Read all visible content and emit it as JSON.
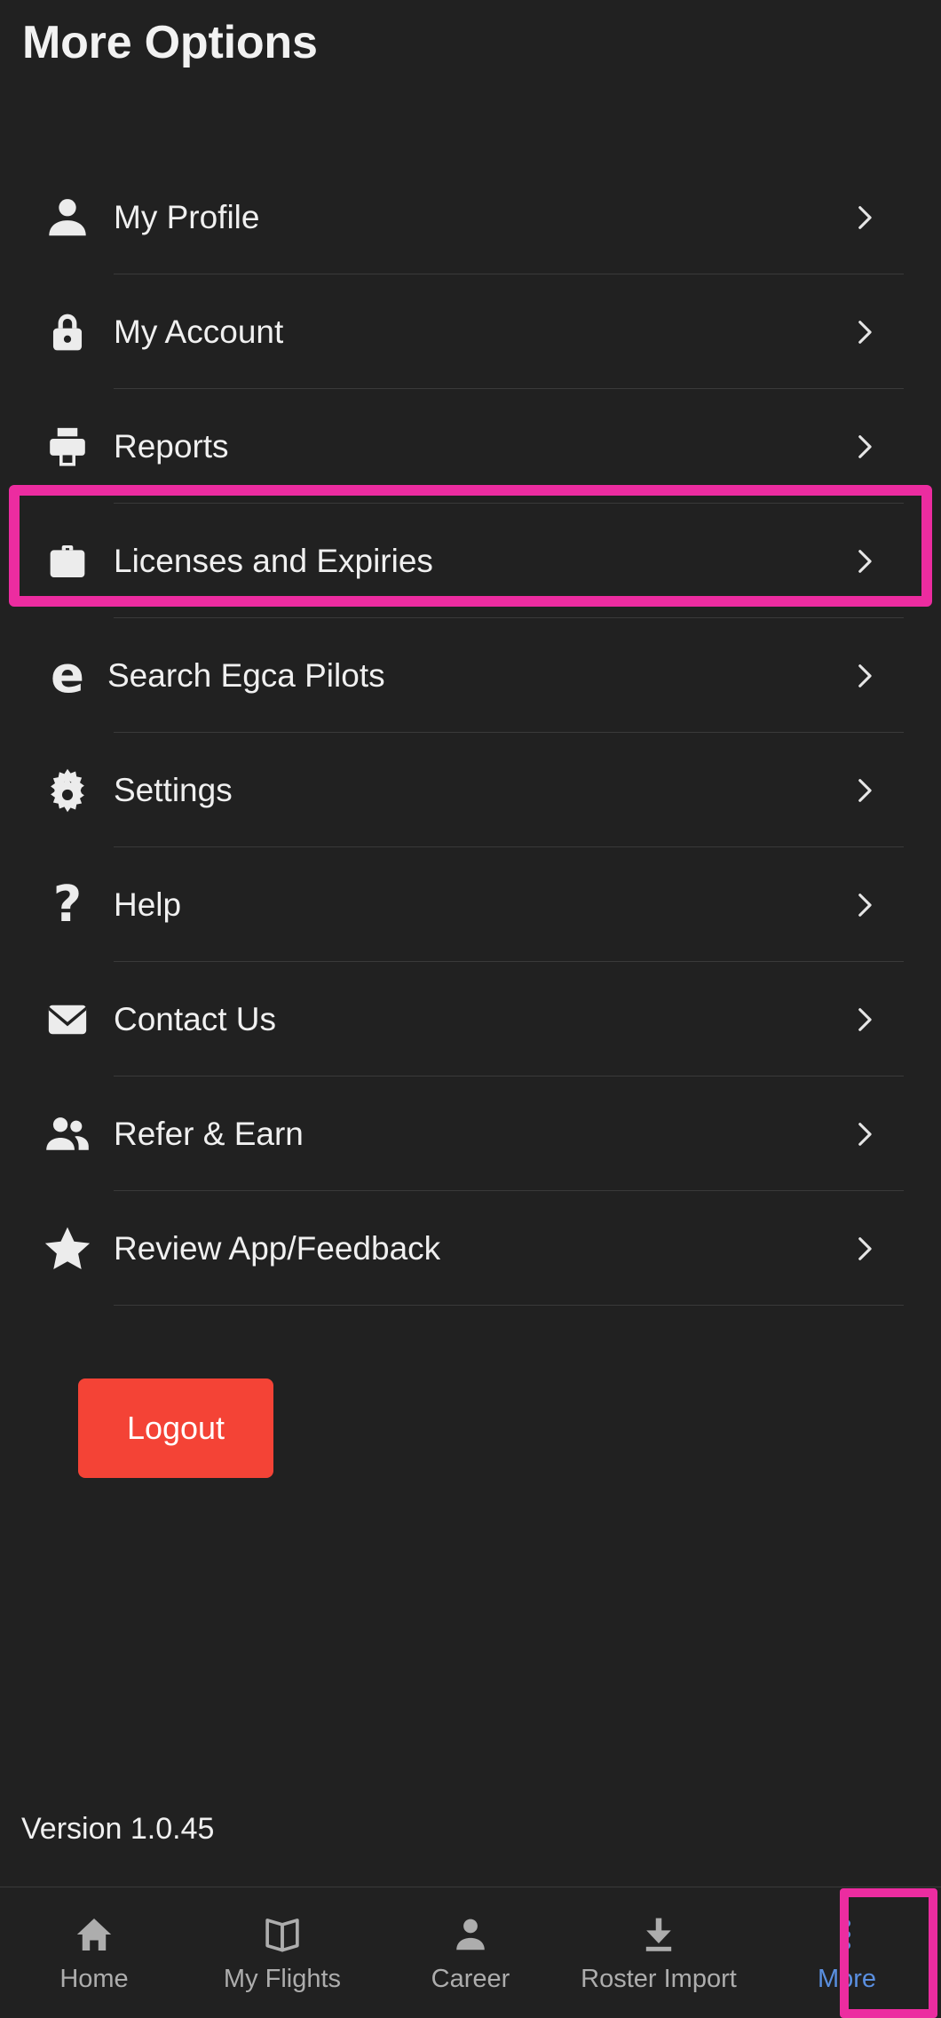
{
  "header": {
    "title": "More Options"
  },
  "menu": {
    "items": [
      {
        "label": "My Profile",
        "icon": "person-icon",
        "chevron": "chevron-right-icon"
      },
      {
        "label": "My Account",
        "icon": "lock-icon",
        "chevron": "chevron-right-icon"
      },
      {
        "label": "Reports",
        "icon": "printer-icon",
        "chevron": "chevron-right-icon"
      },
      {
        "label": "Licenses and Expiries",
        "icon": "briefcase-icon",
        "chevron": "chevron-right-icon"
      },
      {
        "label": "Search Egca Pilots",
        "icon": "letter-e-icon",
        "chevron": "chevron-right-icon"
      },
      {
        "label": "Settings",
        "icon": "gear-icon",
        "chevron": "chevron-right-icon"
      },
      {
        "label": "Help",
        "icon": "question-mark-icon",
        "chevron": "chevron-right-icon"
      },
      {
        "label": "Contact Us",
        "icon": "envelope-icon",
        "chevron": "chevron-right-icon"
      },
      {
        "label": "Refer & Earn",
        "icon": "people-icon",
        "chevron": "chevron-right-icon"
      },
      {
        "label": "Review App/Feedback",
        "icon": "star-icon",
        "chevron": "chevron-right-icon"
      }
    ]
  },
  "logout": {
    "label": "Logout"
  },
  "version": {
    "text": "Version 1.0.45"
  },
  "bottom_nav": {
    "items": [
      {
        "label": "Home",
        "icon": "home-icon",
        "active": false
      },
      {
        "label": "My Flights",
        "icon": "book-icon",
        "active": false
      },
      {
        "label": "Career",
        "icon": "person-icon",
        "active": false
      },
      {
        "label": "Roster Import",
        "icon": "download-icon",
        "active": false
      },
      {
        "label": "More",
        "icon": "dots-vertical-icon",
        "active": true
      }
    ]
  },
  "highlights": [
    {
      "target": "Licenses and Expiries",
      "color": "#ec2ca0"
    },
    {
      "target": "More",
      "color": "#ec2ca0"
    }
  ],
  "colors": {
    "background": "#212121",
    "text": "#f0f0f0",
    "divider": "#3a3a3a",
    "accent_highlight": "#ec2ca0",
    "logout_red": "#f44336",
    "nav_active": "#5a8fe0",
    "nav_inactive": "#adadad"
  }
}
